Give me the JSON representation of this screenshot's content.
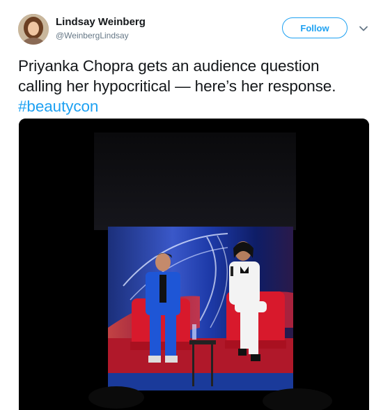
{
  "tweet": {
    "author": {
      "name": "Lindsay Weinberg",
      "handle": "@WeinbergLindsay",
      "avatar_icon": "user-avatar"
    },
    "follow_label": "Follow",
    "menu_icon": "chevron-down-icon",
    "text_line1": "Priyanka Chopra gets an audience question",
    "text_line2": "calling her hypocritical — here’s her response.",
    "hashtag": "#beautycon",
    "media": {
      "type": "video",
      "description_icon": "video-player"
    }
  },
  "colors": {
    "accent": "#1da1f2",
    "text": "#14171a",
    "secondary": "#657786",
    "media_background": "#000000"
  }
}
